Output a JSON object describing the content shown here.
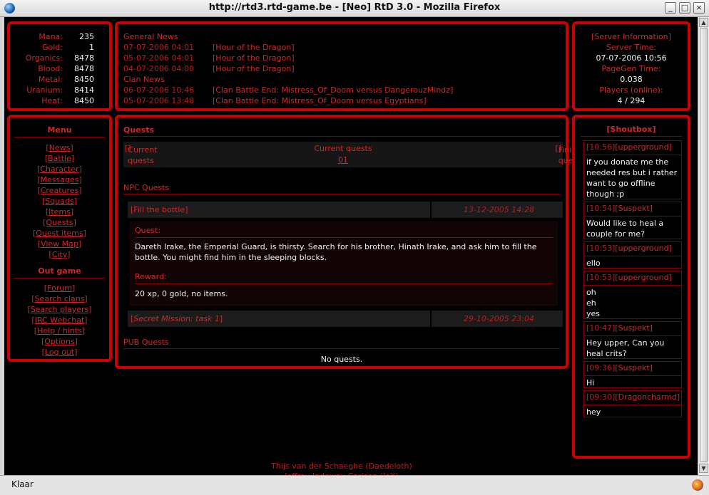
{
  "window": {
    "title": "http://rtd3.rtd-game.be - [Neo] RtD 3.0 - Mozilla Firefox",
    "status": "Klaar"
  },
  "stats": [
    {
      "label": "Mana:",
      "value": "235"
    },
    {
      "label": "Gold:",
      "value": "1"
    },
    {
      "label": "Organics:",
      "value": "8478"
    },
    {
      "label": "Blood:",
      "value": "8478"
    },
    {
      "label": "Metal:",
      "value": "8450"
    },
    {
      "label": "Uranium:",
      "value": "8414"
    },
    {
      "label": "Heat:",
      "value": "8450"
    }
  ],
  "news": {
    "general_title": "General News",
    "general": [
      {
        "date": "07-07-2006 04:01",
        "text": "Hour of the Dragon"
      },
      {
        "date": "05-07-2006 04:01",
        "text": "Hour of the Dragon"
      },
      {
        "date": "04-07-2006 04:00",
        "text": "Hour of the Dragon"
      }
    ],
    "clan_title": "Clan News",
    "clan": [
      {
        "date": "06-07-2006 10:46",
        "text": "Clan Battle End: Mistress_Of_Doom versus DangerouzMindz"
      },
      {
        "date": "05-07-2006 13:48",
        "text": "Clan Battle End: Mistress_Of_Doom versus Egyptians"
      }
    ]
  },
  "server": {
    "title": "[Server Information]",
    "time_label": "Server Time:",
    "time_value": "07-07-2006 10:56",
    "pagegen_label": "PageGen Time:",
    "pagegen_value": "0.038",
    "players_label": "Players (online):",
    "players_value": "4 / 294"
  },
  "menu": {
    "title": "Menu",
    "items": [
      "News",
      "Battle",
      "Character",
      "Messages",
      "Creatures",
      "Squads",
      "Items",
      "Quests",
      "Quest items",
      "View Map",
      "City"
    ],
    "out_title": "Out game",
    "out_items": [
      "Forum",
      "Search clans",
      "Search players",
      "IRC Webchat",
      "Help / hints",
      "Options",
      "Log out"
    ]
  },
  "quests": {
    "title": "Quests",
    "tab_current": "Current quests",
    "center_label": "Current quests",
    "page": "01",
    "tab_finished": "Finished quests",
    "npc_title": "NPC Quests",
    "npc": [
      {
        "name": "Fill the bottle",
        "date": "13-12-2005 14:28"
      },
      {
        "name": "Secret Mission: task 1",
        "date": "29-10-2005 23:04"
      }
    ],
    "detail": {
      "quest_label": "Quest:",
      "quest_text": "Dareth Irake, the Emperial Guard, is thirsty. Search for his brother, Hinath Irake, and ask him to fill the bottle. You might find him in the sleeping blocks.",
      "reward_label": "Reward:",
      "reward_text": "20 xp, 0 gold, no items."
    },
    "pub_title": "PUB Quests",
    "pub_empty": "No quests."
  },
  "shoutbox": {
    "title": "[Shoutbox]",
    "messages": [
      {
        "time": "10:56",
        "user": "upperground",
        "text": "if you donate me the needed res but i rather want to go offline though ;p"
      },
      {
        "time": "10:54",
        "user": "Suspekt",
        "text": "Would like to heal a couple for me?"
      },
      {
        "time": "10:53",
        "user": "upperground",
        "text": "ello"
      },
      {
        "time": "10:53",
        "user": "upperground",
        "text": "oh\neh\nyes"
      },
      {
        "time": "10:47",
        "user": "Suspekt",
        "text": "Hey upper, Can you heal crits?"
      },
      {
        "time": "09:36",
        "user": "Suspekt",
        "text": "Hi"
      },
      {
        "time": "09:30",
        "user": "Dragoncharmd",
        "text": "hey"
      }
    ]
  },
  "footer": {
    "line1": "Thijs van der Schaeghe (Daedeloth)",
    "line2": "Jeffrey Indeway Carlsen (JeX)"
  }
}
